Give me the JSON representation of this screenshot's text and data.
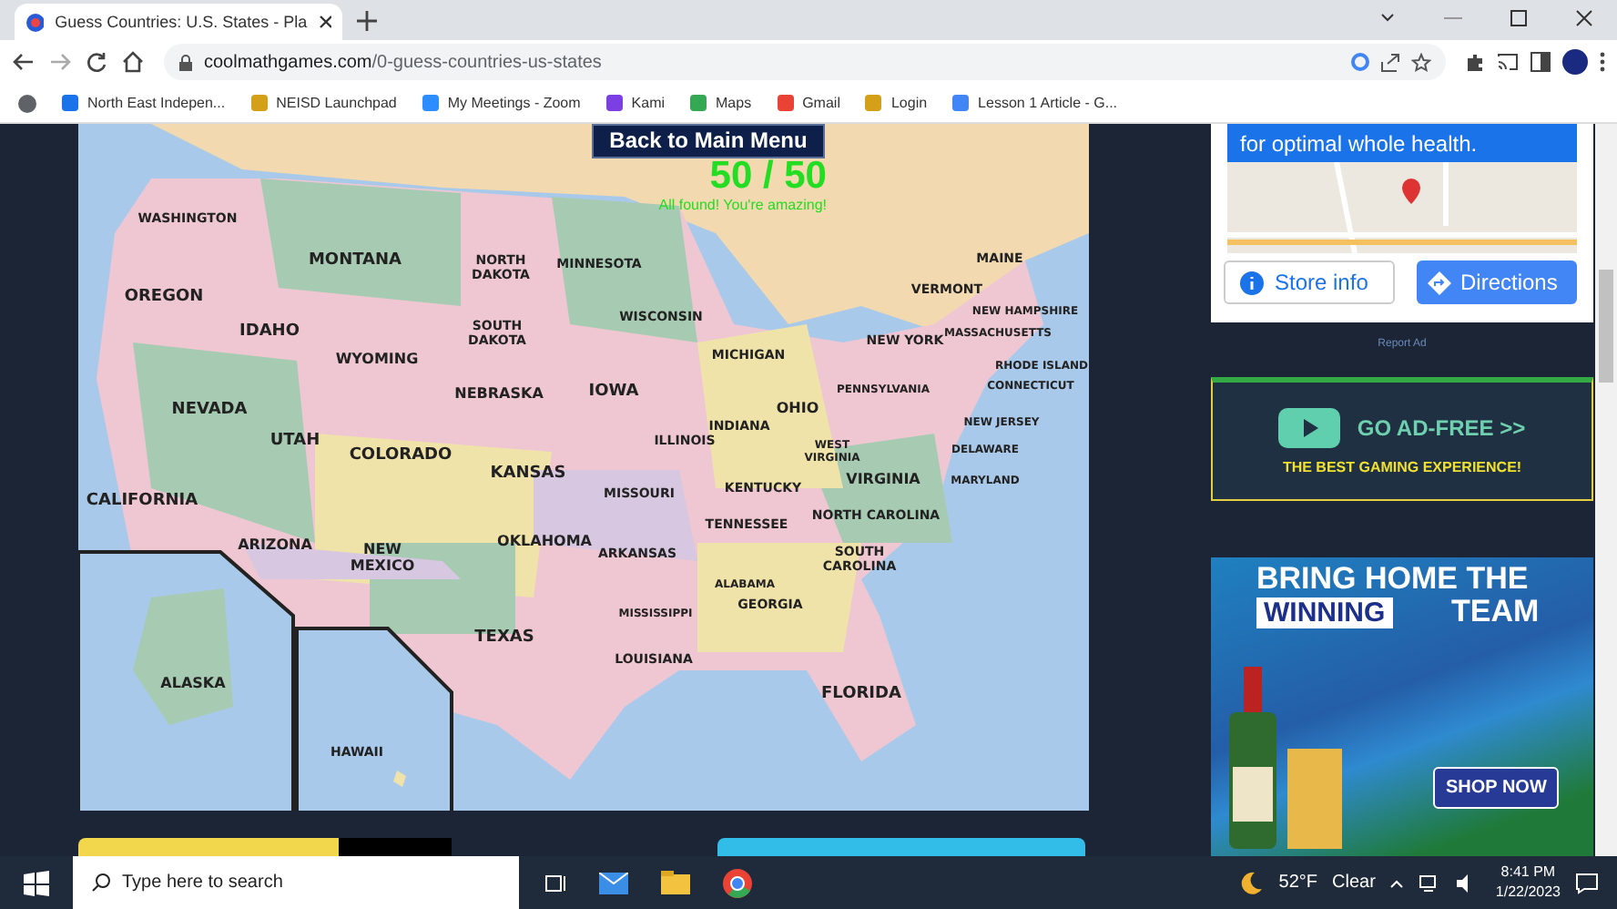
{
  "browser": {
    "tab_title": "Guess Countries: U.S. States - Pla",
    "url_host": "coolmathgames.com",
    "url_path": "/0-guess-countries-us-states",
    "bookmarks": [
      "North East Indepen...",
      "NEISD Launchpad",
      "My Meetings - Zoom",
      "Kami",
      "Maps",
      "Gmail",
      "Login",
      "Lesson 1 Article - G..."
    ]
  },
  "game": {
    "back_button": "Back to Main Menu",
    "score": "50 / 50",
    "message": "All found! You're amazing!",
    "states": [
      {
        "name": "WASHINGTON"
      },
      {
        "name": "MONTANA"
      },
      {
        "name": "NORTH DAKOTA"
      },
      {
        "name": "MINNESOTA"
      },
      {
        "name": "MAINE"
      },
      {
        "name": "OREGON"
      },
      {
        "name": "VERMONT"
      },
      {
        "name": "NEW HAMPSHIRE"
      },
      {
        "name": "WISCONSIN"
      },
      {
        "name": "IDAHO"
      },
      {
        "name": "SOUTH DAKOTA"
      },
      {
        "name": "NEW YORK"
      },
      {
        "name": "MASSACHUSETTS"
      },
      {
        "name": "WYOMING"
      },
      {
        "name": "MICHIGAN"
      },
      {
        "name": "RHODE ISLAND"
      },
      {
        "name": "CONNECTICUT"
      },
      {
        "name": "NEBRASKA"
      },
      {
        "name": "IOWA"
      },
      {
        "name": "PENNSYLVANIA"
      },
      {
        "name": "NEVADA"
      },
      {
        "name": "OHIO"
      },
      {
        "name": "INDIANA"
      },
      {
        "name": "NEW JERSEY"
      },
      {
        "name": "UTAH"
      },
      {
        "name": "COLORADO"
      },
      {
        "name": "ILLINOIS"
      },
      {
        "name": "WEST VIRGINIA"
      },
      {
        "name": "DELAWARE"
      },
      {
        "name": "KANSAS"
      },
      {
        "name": "VIRGINIA"
      },
      {
        "name": "MARYLAND"
      },
      {
        "name": "MISSOURI"
      },
      {
        "name": "KENTUCKY"
      },
      {
        "name": "CALIFORNIA"
      },
      {
        "name": "TENNESSEE"
      },
      {
        "name": "NORTH CAROLINA"
      },
      {
        "name": "ARIZONA"
      },
      {
        "name": "NEW MEXICO"
      },
      {
        "name": "OKLAHOMA"
      },
      {
        "name": "ARKANSAS"
      },
      {
        "name": "SOUTH CAROLINA"
      },
      {
        "name": "ALABAMA"
      },
      {
        "name": "GEORGIA"
      },
      {
        "name": "MISSISSIPPI"
      },
      {
        "name": "TEXAS"
      },
      {
        "name": "LOUISIANA"
      },
      {
        "name": "ALASKA"
      },
      {
        "name": "FLORIDA"
      },
      {
        "name": "HAWAII"
      }
    ]
  },
  "ads": {
    "store_ad": {
      "headline": "for optimal whole health.",
      "store_button": "Store info",
      "directions_button": "Directions"
    },
    "report_ad": "Report Ad",
    "ad_free": {
      "title": "GO AD-FREE >>",
      "subtitle": "THE BEST GAMING EXPERIENCE!"
    },
    "banner": {
      "line_1": "BRING HOME THE",
      "line_2_left": "WINNING",
      "line_2_right": "TEAM",
      "button": "SHOP NOW"
    }
  },
  "taskbar": {
    "search_placeholder": "Type here to search",
    "temperature": "52°F",
    "weather": "Clear",
    "time": "8:41 PM",
    "date": "1/22/2023"
  }
}
